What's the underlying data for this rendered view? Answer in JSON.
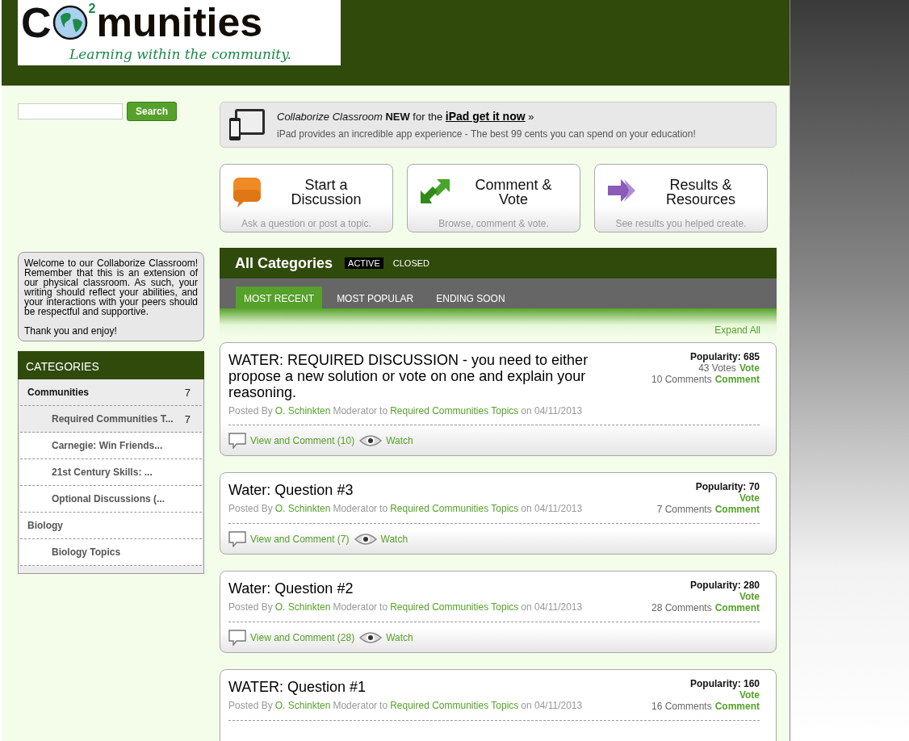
{
  "logo": {
    "lead": "C",
    "sup": "2",
    "main": "munities",
    "tagline": "Learning within the community."
  },
  "search": {
    "button": "Search"
  },
  "promo": {
    "title_italic": "Collaborize Classroom",
    "title_new": "NEW",
    "title_for": "for the",
    "link": "iPad get it now",
    "arrow": "»",
    "subtitle": "iPad provides an incredible app experience - The best 99 cents you can spend on your education!"
  },
  "actions": [
    {
      "kind": "discussion",
      "title": "Start a Discussion",
      "subtitle": "Ask a question or post a topic."
    },
    {
      "kind": "comment",
      "title": "Comment & Vote",
      "subtitle": "Browse, comment & vote."
    },
    {
      "kind": "results",
      "title": "Results & Resources",
      "subtitle": "See results you helped create."
    }
  ],
  "welcome": {
    "paragraphs": [
      "Welcome to our Collaborize Classroom! Remember that this is an extension of our physical classroom. As such, your writing should reflect your abilities, and your interactions with your peers should be respectful and supportive.",
      "Thank you and enjoy!"
    ]
  },
  "categories": {
    "title": "CATEGORIES",
    "items": [
      {
        "label": "Communities",
        "count": "7",
        "selected": true,
        "children": [
          {
            "label": "Required Communities T...",
            "count": "7",
            "selected": true
          },
          {
            "label": "Carnegie: Win Friends...",
            "selected": false
          },
          {
            "label": "21st Century Skills: ...",
            "selected": false
          },
          {
            "label": "Optional Discussions (...",
            "selected": false
          }
        ]
      },
      {
        "label": "Biology",
        "selected": false,
        "children": [
          {
            "label": "Biology Topics",
            "selected": false
          }
        ]
      }
    ]
  },
  "board": {
    "title": "All Categories",
    "filters": [
      {
        "label": "ACTIVE",
        "selected": true
      },
      {
        "label": "CLOSED",
        "selected": false
      }
    ],
    "tabs": [
      {
        "label": "MOST RECENT",
        "selected": true
      },
      {
        "label": "MOST POPULAR",
        "selected": false
      },
      {
        "label": "ENDING SOON",
        "selected": false
      }
    ],
    "expand_all": "Expand All"
  },
  "topics": [
    {
      "title": "WATER: REQUIRED DISCUSSION - you need to either propose a new solution or vote on one and explain your reasoning.",
      "posted_by": "Posted By",
      "author": "O. Schinkten",
      "role": "Moderator",
      "to": "to",
      "category": "Required Communities Topics",
      "on": "on 04/11/2013",
      "popularity": "Popularity: 685",
      "votes": "43 Votes",
      "vote_link": "Vote",
      "comments": "10 Comments",
      "comment_link": "Comment",
      "view": "View and Comment (10)",
      "watch": "Watch"
    },
    {
      "title": "Water: Question #3",
      "posted_by": "Posted By",
      "author": "O. Schinkten",
      "role": "Moderator",
      "to": "to",
      "category": "Required Communities Topics",
      "on": "on 04/11/2013",
      "popularity": "Popularity: 70",
      "vote_link": "Vote",
      "comments": "7 Comments",
      "comment_link": "Comment",
      "view": "View and Comment (7)",
      "watch": "Watch"
    },
    {
      "title": "Water: Question #2",
      "posted_by": "Posted By",
      "author": "O. Schinkten",
      "role": "Moderator",
      "to": "to",
      "category": "Required Communities Topics",
      "on": "on 04/11/2013",
      "popularity": "Popularity: 280",
      "vote_link": "Vote",
      "comments": "28 Comments",
      "comment_link": "Comment",
      "view": "View and Comment (28)",
      "watch": "Watch"
    },
    {
      "title": "WATER: Question #1",
      "posted_by": "Posted By",
      "author": "O. Schinkten",
      "role": "Moderator",
      "to": "to",
      "category": "Required Communities Topics",
      "on": "on 04/11/2013",
      "popularity": "Popularity: 160",
      "vote_link": "Vote",
      "comments": "16 Comments",
      "comment_link": "Comment"
    }
  ]
}
